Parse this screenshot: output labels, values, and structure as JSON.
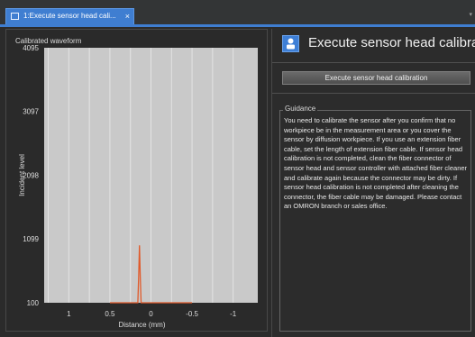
{
  "tab": {
    "label": "1:Execute sensor head cali...",
    "close_glyph": "×",
    "icon": "wave-icon",
    "dropdown_glyph": "▾"
  },
  "chart": {
    "title": "Calibrated waveform",
    "y_axis_label": "Incident level",
    "x_axis_label": "Distance (mm)",
    "y_ticks": [
      "4095",
      "3097",
      "2098",
      "1099",
      "100"
    ],
    "x_ticks": [
      "1",
      "0.5",
      "0",
      "-0.5",
      "-1"
    ]
  },
  "chart_data": {
    "type": "line",
    "title": "Calibrated waveform",
    "xlabel": "Distance (mm)",
    "ylabel": "Incident level",
    "y_ticks": [
      4095,
      3097,
      2098,
      1099,
      100
    ],
    "ylim": [
      100,
      4095
    ],
    "x_ticks": [
      1,
      0.5,
      0,
      -0.5,
      -1
    ],
    "xlim": [
      1.3,
      -1.3
    ],
    "x_reversed": true,
    "grid": true,
    "gridline_x": [
      1.25,
      1.0,
      0.75,
      0.5,
      0.25,
      0,
      -0.25,
      -0.5,
      -0.75,
      -1.0
    ],
    "series": [
      {
        "color": "#e05a2b",
        "x": [
          0.5,
          0.16,
          0.15,
          0.14,
          0.13,
          0.12,
          -0.5
        ],
        "y": [
          100,
          100,
          500,
          1000,
          500,
          100,
          100
        ]
      }
    ]
  },
  "header": {
    "icon": "sensor-head-icon",
    "title": "Execute sensor head calibra"
  },
  "calibrate_button": {
    "label": "Execute sensor head calibration"
  },
  "guidance": {
    "legend": "Guidance",
    "text": "You need to calibrate the sensor after you confirm that no workpiece be in the measurement area or you cover the sensor by diffusion workpiece. If you use an extension fiber cable, set the length of extension fiber cable. If sensor head calibration is not completed, clean the fiber connector of sensor head and sensor controller with attached fiber cleaner and calibrate again because the connector may be dirty. If sensor head calibration is not completed after cleaning the connector, the fiber cable may be damaged. Please contact an OMRON branch or sales office."
  },
  "colors": {
    "accent": "#3f7ed1",
    "waveform": "#e05a2b",
    "plot_background": "#c9c9c9",
    "background": "#2b2b2b"
  }
}
